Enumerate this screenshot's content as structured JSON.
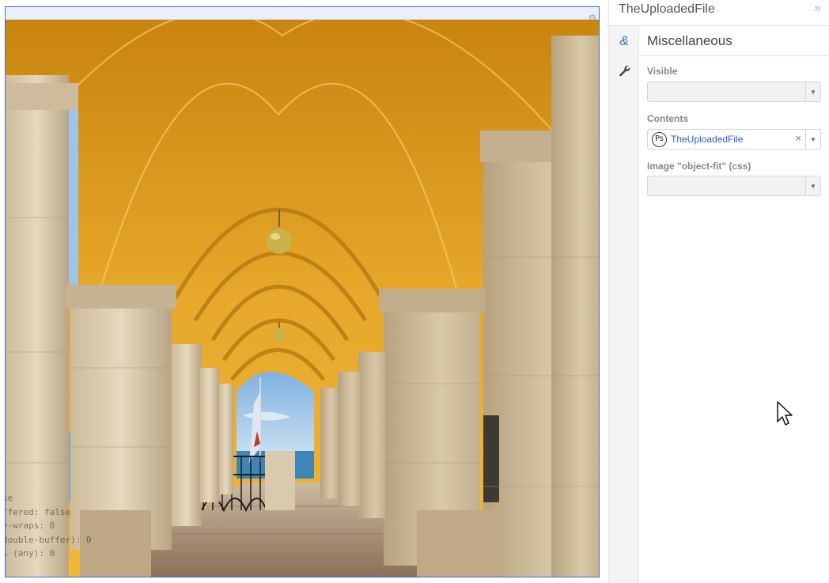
{
  "canvas": {
    "gear_icon": "gear-icon",
    "debug_lines": [
      "se",
      "ffered: false",
      "e-wraps: 0",
      "double-buffer): 0",
      "s (any): 0"
    ]
  },
  "panel": {
    "title": "TheUploadedFile",
    "collapse_label": "»",
    "rail_icons": [
      "ampersand-icon",
      "wrench-icon"
    ],
    "section_title": "Miscellaneous",
    "properties": {
      "visible_label": "Visible",
      "visible_value": "",
      "contents_label": "Contents",
      "contents_value": "TheUploadedFile",
      "contents_badge": "Ps",
      "clear_label": "×",
      "objectfit_label": "Image \"object-fit\" (css)",
      "objectfit_value": ""
    },
    "dropdown_arrow": "▼"
  },
  "colors": {
    "accent": "#3b6fd8",
    "link": "#2b5fc7",
    "ceiling": "#e3a42a"
  }
}
